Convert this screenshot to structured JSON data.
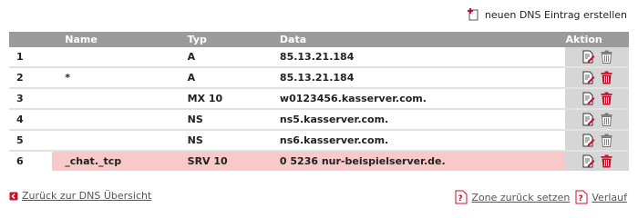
{
  "header": {
    "new_entry_label": "neuen DNS Eintrag erstellen"
  },
  "table": {
    "columns": {
      "nr": "",
      "name": "Name",
      "typ": "Typ",
      "data": "Data",
      "aktion": "Aktion"
    },
    "rows": [
      {
        "nr": "1",
        "name": "",
        "typ": "A",
        "data": "85.13.21.184",
        "deletable": false
      },
      {
        "nr": "2",
        "name": "*",
        "typ": "A",
        "data": "85.13.21.184",
        "deletable": true
      },
      {
        "nr": "3",
        "name": "",
        "typ": "MX 10",
        "data": "w0123456.kasserver.com.",
        "deletable": true
      },
      {
        "nr": "4",
        "name": "",
        "typ": "NS",
        "data": "ns5.kasserver.com.",
        "deletable": false
      },
      {
        "nr": "5",
        "name": "",
        "typ": "NS",
        "data": "ns6.kasserver.com.",
        "deletable": false
      },
      {
        "nr": "6",
        "name": "_chat._tcp",
        "typ": "SRV 10",
        "data": "0 5236 nur-beispielserver.de.",
        "deletable": true,
        "highlighted": true
      }
    ]
  },
  "footer": {
    "back_label": "Zurück zur DNS Übersicht",
    "reset_label": "Zone zurück setzen",
    "history_label": "Verlauf"
  },
  "colors": {
    "header_bg": "#9b9b9b",
    "highlight": "#f9c8c8",
    "accent_red": "#c8102e",
    "action_bg": "#d6d6d6"
  },
  "icons": {
    "new_entry": "add-document-icon",
    "edit": "edit-icon",
    "delete": "trash-icon",
    "back": "back-arrow-icon",
    "reset": "reset-zone-icon",
    "history": "history-icon"
  }
}
